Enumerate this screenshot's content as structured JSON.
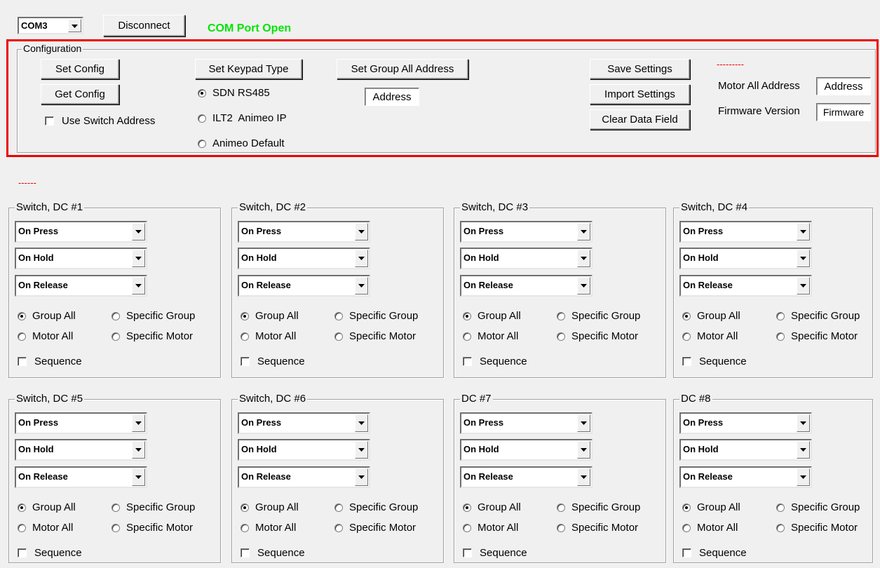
{
  "top": {
    "com_port": "COM3",
    "disconnect_label": "Disconnect",
    "status": "COM Port Open",
    "status_color": "#00e600"
  },
  "config": {
    "title": "Configuration",
    "set_config": "Set Config",
    "get_config": "Get Config",
    "use_switch_address": "Use Switch Address",
    "set_keypad_type": "Set Keypad Type",
    "keypad_options": [
      "SDN RS485",
      "ILT2  Animeo IP",
      "Animeo Default"
    ],
    "keypad_selected": 0,
    "set_group_all_address": "Set Group All Address",
    "group_address": "Address",
    "save_settings": "Save Settings",
    "import_settings": "Import Settings",
    "clear_data_field": "Clear Data Field",
    "red_dashes": "---------",
    "motor_all_address_label": "Motor All Address",
    "motor_all_address_value": "Address",
    "firmware_version_label": "Firmware Version",
    "firmware_value": "Firmware",
    "highlight_color": "#ee0000"
  },
  "status_dashes": "------",
  "switches": [
    {
      "title": "Switch, DC #1"
    },
    {
      "title": "Switch, DC #2"
    },
    {
      "title": "Switch, DC #3"
    },
    {
      "title": "Switch, DC #4"
    },
    {
      "title": "Switch, DC #5"
    },
    {
      "title": "Switch, DC #6"
    },
    {
      "title": "DC #7"
    },
    {
      "title": "DC #8"
    }
  ],
  "switch_common": {
    "on_press": "On Press",
    "on_hold": "On Hold",
    "on_release": "On Release",
    "group_all": "Group All",
    "specific_group": "Specific Group",
    "motor_all": "Motor All",
    "specific_motor": "Specific Motor",
    "sequence": "Sequence",
    "selected": "group_all"
  }
}
